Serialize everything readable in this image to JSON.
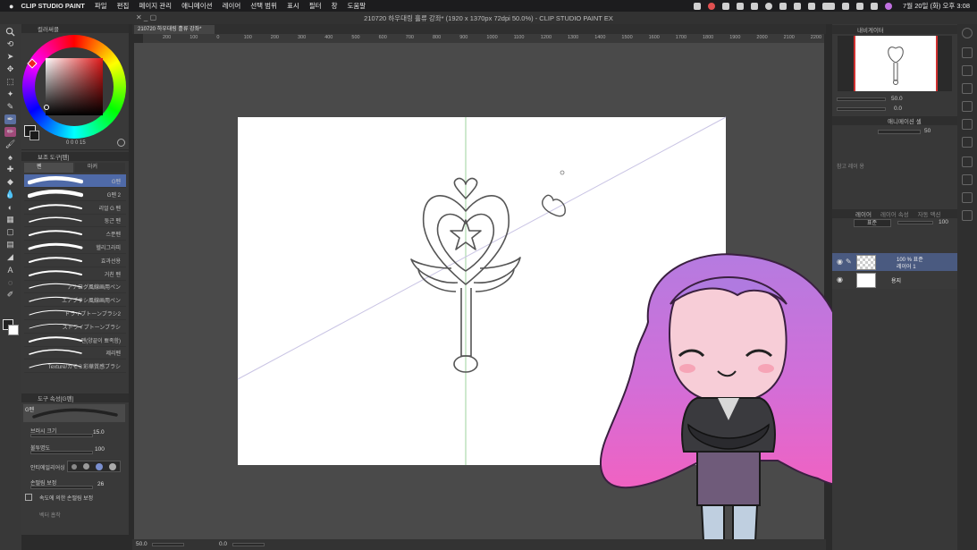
{
  "menubar": {
    "app": "CLIP STUDIO PAINT",
    "items": [
      "파일",
      "편집",
      "페이지 관리",
      "애니메이션",
      "레이어",
      "선택 범위",
      "표시",
      "필터",
      "창",
      "도움말"
    ],
    "datetime": "7월 20일 (화) 오후 3:08"
  },
  "window": {
    "title": "210720 하우대링 흘류 강좌* (1920 x 1370px 72dpi 50.0%)  - CLIP STUDIO PAINT EX",
    "doc_tab": "210720 하우대링 흘류 강좌*"
  },
  "color_panel": {
    "title": "컬러써클",
    "readout": "0 0 0 15"
  },
  "subtool": {
    "header": "보조 도구[펜]",
    "tabs": [
      "펜",
      "마커"
    ],
    "brushes": [
      "G펜",
      "G펜 2",
      "리얼 G 펜",
      "둥근 펜",
      "스푼펜",
      "헬리그라피",
      "효과선용",
      "거친 펜",
      "アナログ風線画用ペン",
      "エアブラシ風線画用ペン",
      "ドライブトーンブラシ2",
      "ストライプトーンブラシ",
      "펜(양끝이 뾰족함)",
      "제리펜",
      "Texture/カモミ彩華質感ブラシ"
    ]
  },
  "tool_property": {
    "header": "도구 속성[G펜]",
    "preview_label": "G펜",
    "brush_size_label": "브러시 크기",
    "brush_size": "15.0",
    "opacity_label": "불투명도",
    "opacity": "100",
    "antialias_label": "안티에일리어싱",
    "stabilization_label": "손떨림 보정",
    "stabilization": "26",
    "speed_stab_label": "속도에 의한 손떨림 보정",
    "vector_label": "벡터 흡착"
  },
  "ruler_ticks": [
    "200",
    "100",
    "0",
    "100",
    "200",
    "300",
    "400",
    "500",
    "600",
    "700",
    "800",
    "900",
    "1000",
    "1100",
    "1200",
    "1300",
    "1400",
    "1500",
    "1600",
    "1700",
    "1800",
    "1900",
    "2000",
    "2100",
    "2200"
  ],
  "statusbar": {
    "zoom": "50.0",
    "angle": "0.0"
  },
  "navigator": {
    "title": "내비게이터",
    "zoom": "50.0",
    "rotate": "0.0"
  },
  "animation": {
    "title": "애니메이션 셀",
    "value": "50",
    "note": "참고 레이 용"
  },
  "layers": {
    "title": "레이어",
    "tabs": [
      "레이어",
      "레이어 속성",
      "자동 액션"
    ],
    "blend_mode": "표준",
    "opacity": "100",
    "items": [
      {
        "name_line1": "100 % 표준",
        "name_line2": "레이어 1"
      },
      {
        "name_line1": "",
        "name_line2": "용지"
      }
    ]
  }
}
